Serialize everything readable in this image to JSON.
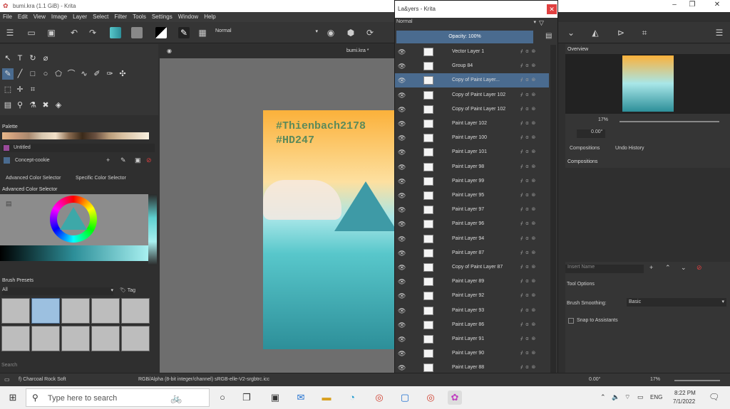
{
  "app": {
    "title": "bumi.kra (1.1 GiB) - Krita",
    "doc_tab": "bumi.kra *"
  },
  "menu": [
    "File",
    "Edit",
    "View",
    "Image",
    "Layer",
    "Select",
    "Filter",
    "Tools",
    "Settings",
    "Window",
    "Help"
  ],
  "toolbar": {
    "blend_mode": "Normal"
  },
  "layers_dialog": {
    "title": "La&yers - Krita",
    "blend_mode": "Normal",
    "opacity": "Opacity:  100%",
    "items": [
      {
        "name": "Vector Layer 1"
      },
      {
        "name": "Group 84"
      },
      {
        "name": "Copy of Paint Layer...",
        "selected": true
      },
      {
        "name": "Copy of Paint Layer 102"
      },
      {
        "name": "Copy of Paint Layer 102"
      },
      {
        "name": "Paint Layer 102"
      },
      {
        "name": "Paint Layer 100"
      },
      {
        "name": "Paint Layer 101"
      },
      {
        "name": "Paint Layer 98"
      },
      {
        "name": "Paint Layer 99"
      },
      {
        "name": "Paint Layer 95"
      },
      {
        "name": "Paint Layer 97"
      },
      {
        "name": "Paint Layer 96"
      },
      {
        "name": "Paint Layer 94"
      },
      {
        "name": "Paint Layer 87"
      },
      {
        "name": "Copy of Paint Layer 87"
      },
      {
        "name": "Paint Layer 89"
      },
      {
        "name": "Paint Layer 92"
      },
      {
        "name": "Paint Layer 93"
      },
      {
        "name": "Paint Layer 86"
      },
      {
        "name": "Paint Layer 91"
      },
      {
        "name": "Paint Layer 90"
      },
      {
        "name": "Paint Layer 88"
      },
      {
        "name": "Paint Layer 85"
      }
    ]
  },
  "left": {
    "palette_header": "Palette",
    "palette_name": "Untitled",
    "brush_tag_set": "Concept-cookie",
    "selector_tabs": [
      "Advanced Color Selector",
      "Specific Color Selector"
    ],
    "adv_selector_header": "Advanced Color Selector",
    "brush_presets_header": "Brush Presets",
    "brush_filter": "All",
    "tag_label": "Tag",
    "search_placeholder": "Search"
  },
  "canvas": {
    "text_line1": "#Thienbach2178",
    "text_line2": "#HD247"
  },
  "right": {
    "overview_header": "Overview",
    "zoom": "17%",
    "rotation": "0.00°",
    "tabs": [
      "Compositions",
      "Undo History"
    ],
    "compositions_header": "Compositions",
    "insert_name_placeholder": "Insert Name",
    "tool_options": "Tool Options",
    "brush_smoothing_label": "Brush Smoothing:",
    "brush_smoothing_value": "Basic",
    "snap_label": "Snap to Assistants"
  },
  "status": {
    "brush": "f) Charcoal Rock Soft",
    "color_info": "RGB/Alpha (8-bit integer/channel)  sRGB-elle-V2-srgbtrc.icc",
    "rotation": "0.00°",
    "zoom": "17%"
  },
  "taskbar": {
    "search_placeholder": "Type here to search",
    "time": "8:22 PM",
    "date": "7/1/2022",
    "lang": "ENG"
  },
  "colors": {
    "accent": "#4a6b8f",
    "bg": "#353535",
    "canvas_bg": "#6e6e6e",
    "close": "#e04040"
  }
}
